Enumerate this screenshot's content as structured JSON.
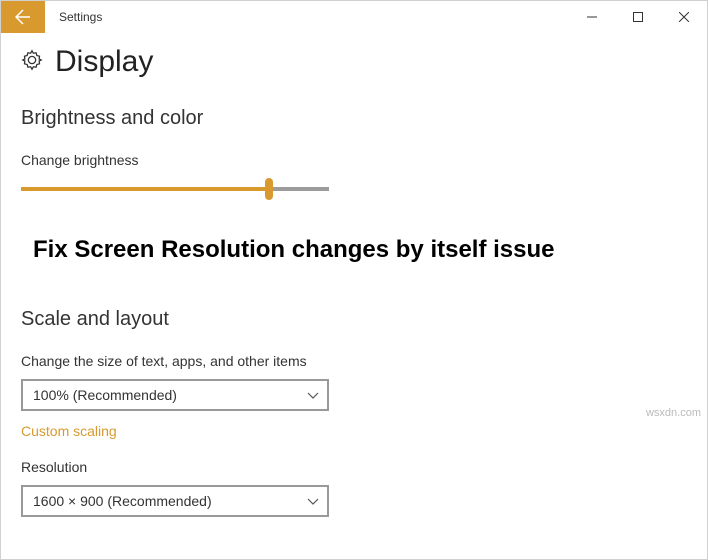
{
  "window": {
    "title": "Settings"
  },
  "page": {
    "title": "Display"
  },
  "sections": {
    "brightness": {
      "heading": "Brightness and color",
      "slider_label": "Change brightness"
    },
    "banner": "Fix Screen Resolution changes by itself issue",
    "scale": {
      "heading": "Scale and layout",
      "size_label": "Change the size of text, apps, and other items",
      "size_value": "100% (Recommended)",
      "custom_link": "Custom scaling",
      "resolution_label": "Resolution",
      "resolution_value": "1600 × 900 (Recommended)"
    }
  },
  "watermark": "wsxdn.com"
}
